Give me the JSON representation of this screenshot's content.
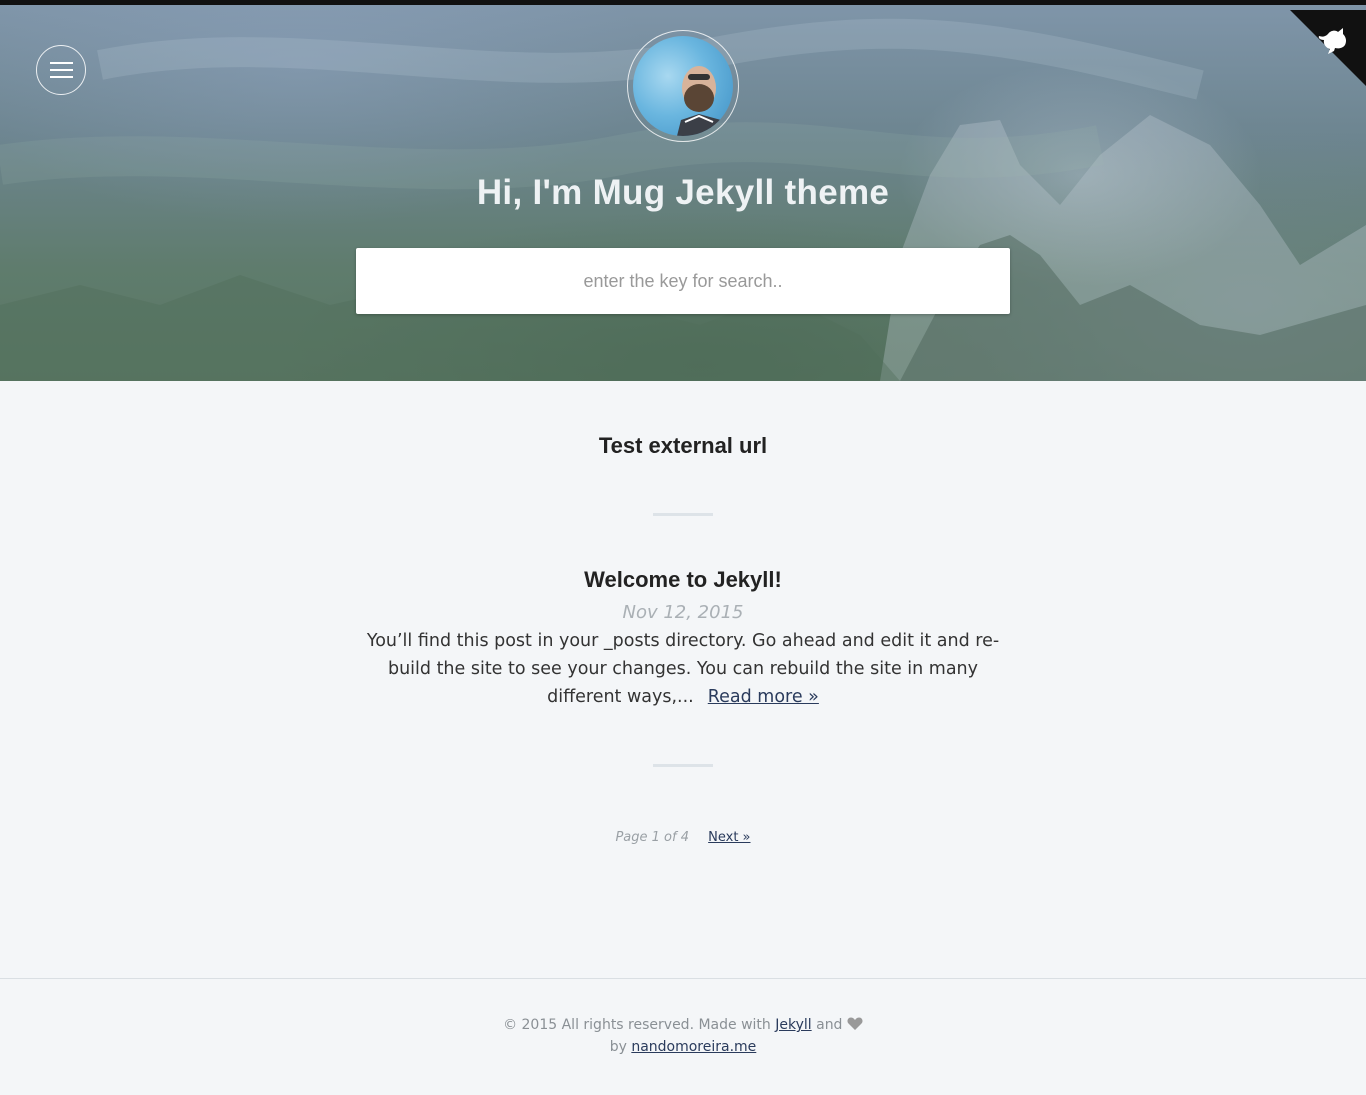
{
  "header": {
    "title": "Hi, I'm Mug Jekyll theme",
    "search_placeholder": "enter the key for search..",
    "menu_icon": "hamburger-menu-icon",
    "corner_icon": "github-octocat-icon"
  },
  "posts": [
    {
      "title": "Test external url"
    },
    {
      "title": "Welcome to Jekyll!",
      "date": "Nov 12, 2015",
      "excerpt": "You’ll find this post in your _posts directory. Go ahead and edit it and re-build the site to see your changes. You can rebuild the site in many different ways,...",
      "read_more": "Read more »"
    }
  ],
  "pagination": {
    "info": "Page 1 of 4",
    "next": "Next »"
  },
  "footer": {
    "copyright": "© 2015 All rights reserved. Made with",
    "jekyll_link": "Jekyll",
    "and": "and",
    "by": "by",
    "author_link": "nandomoreira.me",
    "heart_icon": "heart-icon"
  },
  "colors": {
    "link": "#2a3b5c",
    "background": "#f4f6f8",
    "top_bar": "#111111"
  }
}
